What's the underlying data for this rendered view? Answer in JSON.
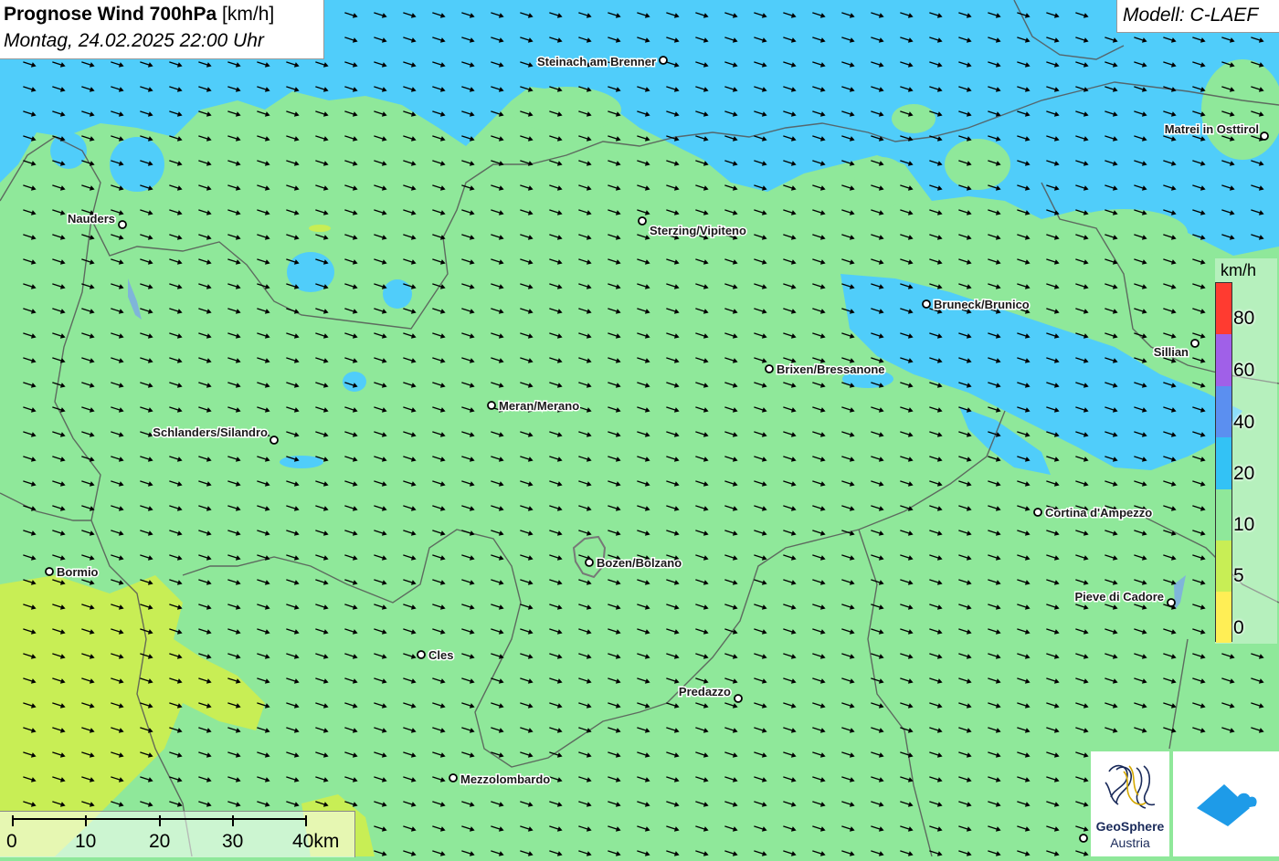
{
  "title": {
    "main": "Prognose Wind 700hPa",
    "unit": "[km/h]",
    "datetime": "Montag, 24.02.2025 22:00 Uhr"
  },
  "model": "Modell: C-LAEF",
  "legend": {
    "unit": "km/h",
    "labels": [
      "80",
      "60",
      "40",
      "20",
      "10",
      "5",
      "0"
    ],
    "colors": [
      "#ff3b30",
      "#a060e8",
      "#5b8ff0",
      "#33c2f5",
      "#8fe89a",
      "#c8ee55",
      "#ffee55"
    ]
  },
  "scale_bar": {
    "labels": [
      "0",
      "10",
      "20",
      "30",
      "40km"
    ]
  },
  "cities": [
    {
      "name": "Steinach am Brenner",
      "id": "steinach"
    },
    {
      "name": "Matrei in Osttirol",
      "id": "matrei"
    },
    {
      "name": "Nauders",
      "id": "nauders"
    },
    {
      "name": "Sterzing/Vipiteno",
      "id": "sterzing"
    },
    {
      "name": "Bruneck/Brunico",
      "id": "bruneck"
    },
    {
      "name": "Sillian",
      "id": "sillian"
    },
    {
      "name": "Brixen/Bressanone",
      "id": "brixen"
    },
    {
      "name": "Meran/Merano",
      "id": "meran"
    },
    {
      "name": "Schlanders/Silandro",
      "id": "schlanders"
    },
    {
      "name": "Cortina d'Ampezzo",
      "id": "cortina"
    },
    {
      "name": "Bormio",
      "id": "bormio"
    },
    {
      "name": "Bozen/Bolzano",
      "id": "bozen"
    },
    {
      "name": "Pieve di Cadore",
      "id": "pieve"
    },
    {
      "name": "Cles",
      "id": "cles"
    },
    {
      "name": "Predazzo",
      "id": "predazzo"
    },
    {
      "name": "Mezzolombardo",
      "id": "mezzolombardo"
    }
  ],
  "logos": {
    "geosphere_line1": "GeoSphere",
    "geosphere_line2": "Austria"
  },
  "wind": {
    "direction": "west-northwest"
  },
  "colors": {
    "band_10_20": "#8fe89a",
    "band_20_40": "#50cdfa",
    "band_5_10": "#c8ee55",
    "border": "#555555",
    "arrow": "#000000"
  }
}
